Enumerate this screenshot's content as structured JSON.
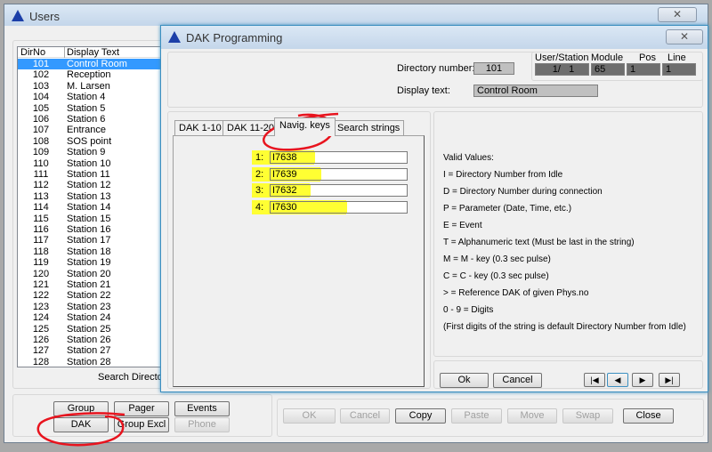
{
  "users_window": {
    "title": "Users",
    "close": "✕",
    "list": {
      "headers": [
        "DirNo",
        "Display Text"
      ],
      "rows": [
        [
          "101",
          "Control Room"
        ],
        [
          "102",
          "Reception"
        ],
        [
          "103",
          "M. Larsen"
        ],
        [
          "104",
          "Station 4"
        ],
        [
          "105",
          "Station 5"
        ],
        [
          "106",
          "Station 6"
        ],
        [
          "107",
          "Entrance"
        ],
        [
          "108",
          "SOS point"
        ],
        [
          "109",
          "Station 9"
        ],
        [
          "110",
          "Station 10"
        ],
        [
          "111",
          "Station 11"
        ],
        [
          "112",
          "Station 12"
        ],
        [
          "113",
          "Station 13"
        ],
        [
          "114",
          "Station 14"
        ],
        [
          "115",
          "Station 15"
        ],
        [
          "116",
          "Station 16"
        ],
        [
          "117",
          "Station 17"
        ],
        [
          "118",
          "Station 18"
        ],
        [
          "119",
          "Station 19"
        ],
        [
          "120",
          "Station 20"
        ],
        [
          "121",
          "Station 21"
        ],
        [
          "122",
          "Station 22"
        ],
        [
          "123",
          "Station 23"
        ],
        [
          "124",
          "Station 24"
        ],
        [
          "125",
          "Station 25"
        ],
        [
          "126",
          "Station 26"
        ],
        [
          "127",
          "Station 27"
        ],
        [
          "128",
          "Station 28"
        ]
      ],
      "selected": "101"
    },
    "search_label": "Search Director",
    "buttons": {
      "group": "Group",
      "pager": "Pager",
      "events": "Events",
      "dak": "DAK",
      "group_excl": "Group Excl",
      "phone": "Phone"
    },
    "actions": {
      "ok": "OK",
      "cancel": "Cancel",
      "copy": "Copy",
      "paste": "Paste",
      "move": "Move",
      "swap": "Swap",
      "close": "Close"
    }
  },
  "dak_window": {
    "title": "DAK Programming",
    "close": "✕",
    "directory_label": "Directory number:",
    "directory_value": "101",
    "display_label": "Display text:",
    "display_value": "Control Room",
    "user_station_label": "User/Station",
    "user_station_value": "1/   1",
    "module_label": "Module",
    "module_value": "65",
    "pos_label": "Pos",
    "pos_value": "1",
    "line_label": "Line",
    "line_value": "1",
    "tabs": [
      "DAK 1-10",
      "DAK 11-20",
      "Navig. keys",
      "Search strings"
    ],
    "active_tab": "Navig. keys",
    "keys": [
      {
        "label": "1:",
        "value": "I7638"
      },
      {
        "label": "2:",
        "value": "I7639"
      },
      {
        "label": "3:",
        "value": "I7632"
      },
      {
        "label": "4:",
        "value": "I7630"
      }
    ],
    "valid_values": [
      "Valid Values:",
      "I = Directory Number from Idle",
      "D = Directory Number during connection",
      "P = Parameter (Date, Time, etc.)",
      "E = Event",
      "T = Alphanumeric text (Must be last in the string)",
      "M = M - key (0.3 sec pulse)",
      "C = C - key (0.3 sec pulse)",
      "> = Reference DAK of given Phys.no",
      "0 - 9 = Digits",
      "(First digits of the string is default Directory Number from Idle)"
    ],
    "ok": "Ok",
    "cancel": "Cancel",
    "nav_icons": [
      "first-icon",
      "prev-icon",
      "next-icon",
      "last-icon"
    ]
  },
  "colors": {
    "highlight": "#ffff33",
    "annotation": "#e8141e",
    "selection": "#3399ff"
  }
}
